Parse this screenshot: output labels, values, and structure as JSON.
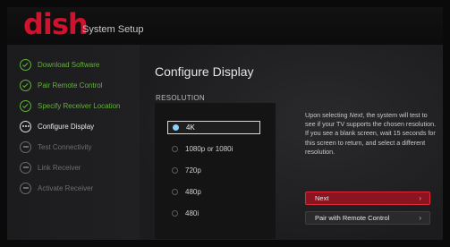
{
  "header": {
    "logo": "dish",
    "title": "System Setup"
  },
  "sidebar": {
    "steps": [
      {
        "label": "Download Software",
        "state": "done"
      },
      {
        "label": "Pair Remote Control",
        "state": "done"
      },
      {
        "label": "Specify Receiver Location",
        "state": "done"
      },
      {
        "label": "Configure Display",
        "state": "current"
      },
      {
        "label": "Test Connectivity",
        "state": "pending"
      },
      {
        "label": "Link Receiver",
        "state": "pending"
      },
      {
        "label": "Activate Receiver",
        "state": "pending"
      }
    ]
  },
  "main": {
    "title": "Configure Display",
    "section_label": "RESOLUTION",
    "options": [
      "4K",
      "1080p or 1080i",
      "720p",
      "480p",
      "480i"
    ],
    "selected_option": "4K",
    "help": {
      "prefix": "Upon selecting ",
      "emphasis": "Next",
      "rest": ", the system will test to see if your TV supports the chosen resolution. If you see a blank screen, wait 15 seconds for this screen to return, and select a different resolution."
    },
    "buttons": {
      "next": "Next",
      "pair": "Pair with Remote Control"
    }
  },
  "colors": {
    "brand": "#d0122c",
    "done": "#63b23a",
    "primary_button": "#8a1420"
  }
}
